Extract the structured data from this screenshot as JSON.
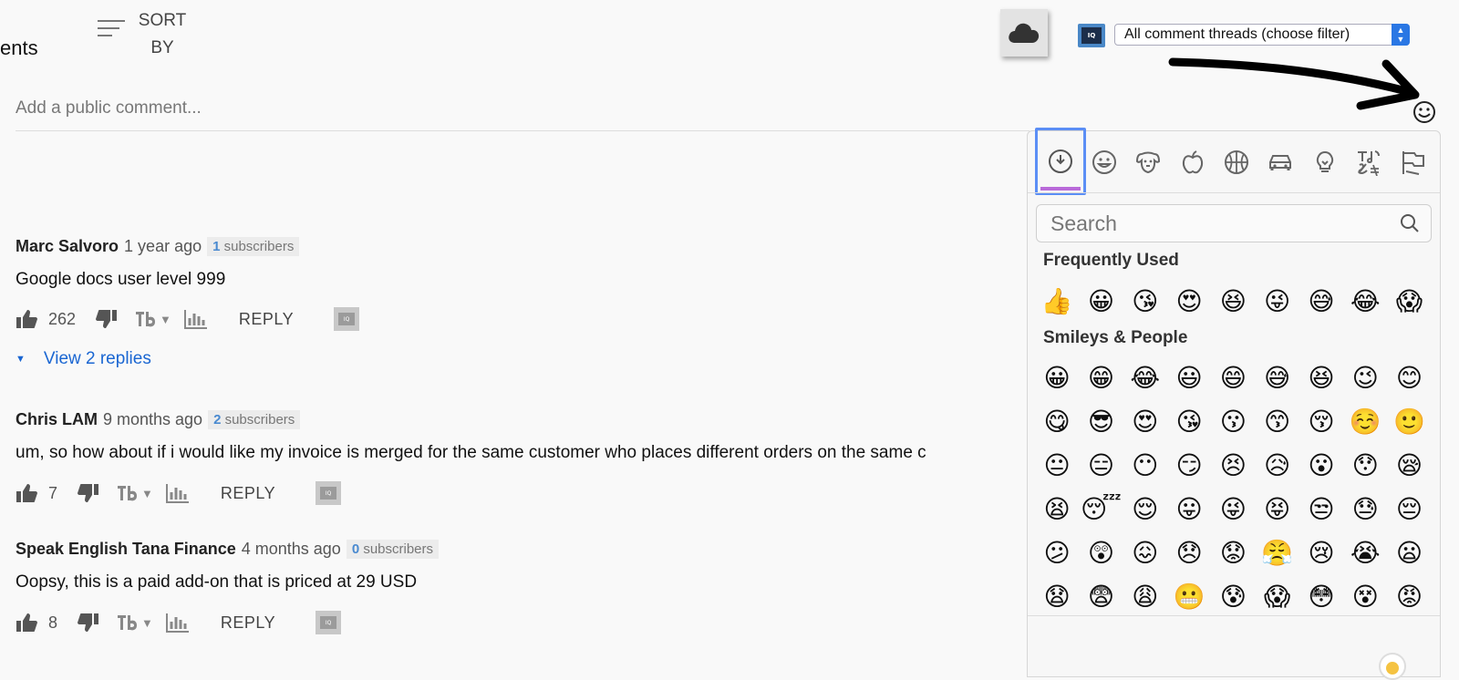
{
  "header": {
    "comments_label": "ents",
    "sort_line1": "SORT",
    "sort_line2": "BY",
    "filter_value": "All comment threads (choose filter)",
    "logo_text": "IQ"
  },
  "compose": {
    "placeholder": "Add a public comment..."
  },
  "comments": [
    {
      "author": "Marc Salvoro",
      "time": "1 year ago",
      "subs_count": "1",
      "subs_label": "subscribers",
      "text": "Google docs user level 999",
      "likes": "262",
      "reply": "REPLY"
    },
    {
      "author": "Chris LAM",
      "time": "9 months ago",
      "subs_count": "2",
      "subs_label": "subscribers",
      "text": "um, so how about if i would like my invoice is merged for the same customer who places different orders on the same c",
      "likes": "7",
      "reply": "REPLY"
    },
    {
      "author": "Speak English Tana Finance",
      "time": "4 months ago",
      "subs_count": "0",
      "subs_label": "subscribers",
      "text": "Oopsy, this is a paid add-on that is priced at 29 USD",
      "likes": "8",
      "reply": "REPLY"
    }
  ],
  "view_replies": "View 2 replies",
  "emoji_picker": {
    "search_placeholder": "Search",
    "frequently_used_title": "Frequently Used",
    "smileys_title": "Smileys & People",
    "categories": [
      "recent-icon",
      "smiley-icon",
      "dog-icon",
      "apple-icon",
      "basketball-icon",
      "car-icon",
      "lightbulb-icon",
      "symbols-icon",
      "flags-icon"
    ],
    "frequently_used": [
      "👍",
      "😀",
      "😘",
      "😍",
      "😆",
      "😜",
      "😅",
      "😂",
      "😱"
    ],
    "smileys": [
      [
        "😀",
        "😁",
        "😂",
        "😃",
        "😄",
        "😅",
        "😆",
        "😉",
        "😊"
      ],
      [
        "😋",
        "😎",
        "😍",
        "😘",
        "😗",
        "😙",
        "😚",
        "☺️",
        "🙂"
      ],
      [
        "😐",
        "😑",
        "😶",
        "😏",
        "😣",
        "😥",
        "😮",
        "😯",
        "😪"
      ],
      [
        "😫",
        "😴",
        "😌",
        "😛",
        "😜",
        "😝",
        "😒",
        "😓",
        "😔"
      ],
      [
        "😕",
        "😲",
        "😖",
        "😞",
        "😟",
        "😤",
        "😢",
        "😭",
        "😦"
      ],
      [
        "😧",
        "😨",
        "😩",
        "😬",
        "😰",
        "😱",
        "😳",
        "😵",
        "😡"
      ]
    ]
  }
}
